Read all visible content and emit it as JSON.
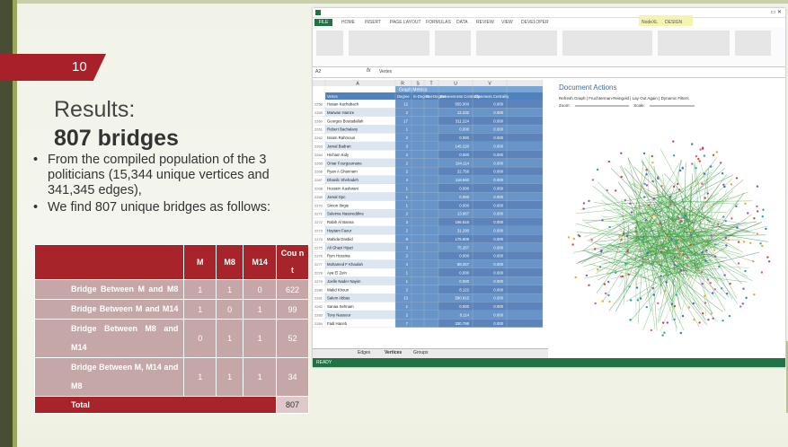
{
  "slide": {
    "number": "10",
    "title": "Results:",
    "subtitle": "807 bridges",
    "bullets": [
      "From the compiled population of the 3 politicians (15,344 unique vertices and 341,345 edges),",
      "We find 807 unique bridges as follows:"
    ]
  },
  "table": {
    "headers": [
      "",
      "M",
      "M8",
      "M14",
      "Cou nt"
    ],
    "rows": [
      {
        "label": "Bridge Between M and M8",
        "m": "1",
        "m8": "1",
        "m14": "0",
        "count": "622"
      },
      {
        "label": "Bridge Between M and M14",
        "m": "1",
        "m8": "0",
        "m14": "1",
        "count": "99"
      },
      {
        "label": "Bridge Between M8 and M14",
        "m": "0",
        "m8": "1",
        "m14": "1",
        "count": "52"
      },
      {
        "label": "Bridge Between M, M14 and M8",
        "m": "1",
        "m8": "1",
        "m14": "1",
        "count": "34"
      }
    ],
    "total": {
      "label": "Total",
      "count": "807"
    }
  },
  "excel": {
    "file_tab": "FILE",
    "ribbon_tabs": [
      "HOME",
      "INSERT",
      "PAGE LAYOUT",
      "FORMULAS",
      "DATA",
      "REVIEW",
      "VIEW",
      "DEVELOPER",
      "NodeXL",
      "DESIGN"
    ],
    "cell_ref": "A2",
    "formula": "Vertex",
    "group_header": "Graph Metrics",
    "columns": [
      "A",
      "R",
      "S",
      "T",
      "U",
      "V"
    ],
    "header_row": [
      "Vertex",
      "Degree",
      "In-Degree",
      "Out-Degree",
      "Betweenness Centrality",
      "Closeness Centrality"
    ],
    "rows": [
      {
        "n": "2258",
        "name": "Hasan Kachabach",
        "deg": "12",
        "btw": "555.000",
        "clo": "0.000"
      },
      {
        "n": "2259",
        "name": "Marwan Hamze",
        "deg": "2",
        "btw": "12.232",
        "clo": "0.000"
      },
      {
        "n": "2260",
        "name": "Georges Boutadallah",
        "deg": "17",
        "btw": "311.224",
        "clo": "0.000"
      },
      {
        "n": "2261",
        "name": "Robert Bachalany",
        "deg": "1",
        "btw": "0.000",
        "clo": "0.000"
      },
      {
        "n": "2262",
        "name": "Issam Rahmoun",
        "deg": "2",
        "btw": "0.000",
        "clo": "0.000"
      },
      {
        "n": "2263",
        "name": "Jamal Badran",
        "deg": "3",
        "btw": "145.220",
        "clo": "0.000"
      },
      {
        "n": "2264",
        "name": "Hicham Kidy",
        "deg": "2",
        "btw": "0.000",
        "clo": "0.000"
      },
      {
        "n": "2265",
        "name": "Omar Fourgoumane",
        "deg": "2",
        "btw": "194.114",
        "clo": "0.000"
      },
      {
        "n": "2266",
        "name": "Ryan A Ghannam",
        "deg": "2",
        "btw": "22.756",
        "clo": "0.000"
      },
      {
        "n": "2267",
        "name": "Dhavilc Shehadeh",
        "deg": "4",
        "btw": "118.540",
        "clo": "0.000"
      },
      {
        "n": "2268",
        "name": "Hussein Kasfarani",
        "deg": "1",
        "btw": "0.000",
        "clo": "0.000"
      },
      {
        "n": "2269",
        "name": "Jamal Gpc",
        "deg": "1",
        "btw": "0.000",
        "clo": "0.000"
      },
      {
        "n": "2270",
        "name": "Simon Ibrgie",
        "deg": "1",
        "btw": "0.000",
        "clo": "0.000"
      },
      {
        "n": "2271",
        "name": "Suleima Nassreddine",
        "deg": "2",
        "btw": "13.667",
        "clo": "0.000"
      },
      {
        "n": "2272",
        "name": "Rabih Al Banna",
        "deg": "3",
        "btw": "196.616",
        "clo": "0.000"
      },
      {
        "n": "2273",
        "name": "Haytam Faour",
        "deg": "2",
        "btw": "31.290",
        "clo": "0.000"
      },
      {
        "n": "2274",
        "name": "Mahida Dasbid",
        "deg": "8",
        "btw": "175.808",
        "clo": "0.000"
      },
      {
        "n": "2275",
        "name": "Ali Ghazi Hijazi",
        "deg": "3",
        "btw": "75.267",
        "clo": "0.000"
      },
      {
        "n": "2276",
        "name": "Rym Hussina",
        "deg": "2",
        "btw": "0.000",
        "clo": "0.000"
      },
      {
        "n": "2277",
        "name": "Mohamed F Khaolah",
        "deg": "4",
        "btw": "88.257",
        "clo": "0.000"
      },
      {
        "n": "2278",
        "name": "Aya El Zein",
        "deg": "1",
        "btw": "0.000",
        "clo": "0.000"
      },
      {
        "n": "2279",
        "name": "Joelle Nader Nayim",
        "deg": "1",
        "btw": "0.000",
        "clo": "0.000"
      },
      {
        "n": "2280",
        "name": "Walid Khoun",
        "deg": "2",
        "btw": "8.122",
        "clo": "0.000"
      },
      {
        "n": "2281",
        "name": "Salem Abbas",
        "deg": "13",
        "btw": "580.815",
        "clo": "0.000"
      },
      {
        "n": "2282",
        "name": "Sanaa Sehnam",
        "deg": "1",
        "btw": "0.000",
        "clo": "0.000"
      },
      {
        "n": "2283",
        "name": "Tony Nassour",
        "deg": "2",
        "btw": "8.114",
        "clo": "0.000"
      },
      {
        "n": "2284",
        "name": "Fadi Haceb",
        "deg": "7",
        "btw": "330.798",
        "clo": "0.000"
      }
    ],
    "sheet_tabs": [
      "Edges",
      "Vertices",
      "Groups"
    ],
    "status_text": "READY",
    "doc_actions": {
      "title": "Document Actions",
      "toolbar": [
        "Refresh Graph",
        "Fruchterman-Reingold",
        "Lay Out Again",
        "Dynamic Filters"
      ],
      "zoom_label": "Zoom:",
      "scale_label": "Scale:"
    },
    "accent_color": "#217346"
  }
}
